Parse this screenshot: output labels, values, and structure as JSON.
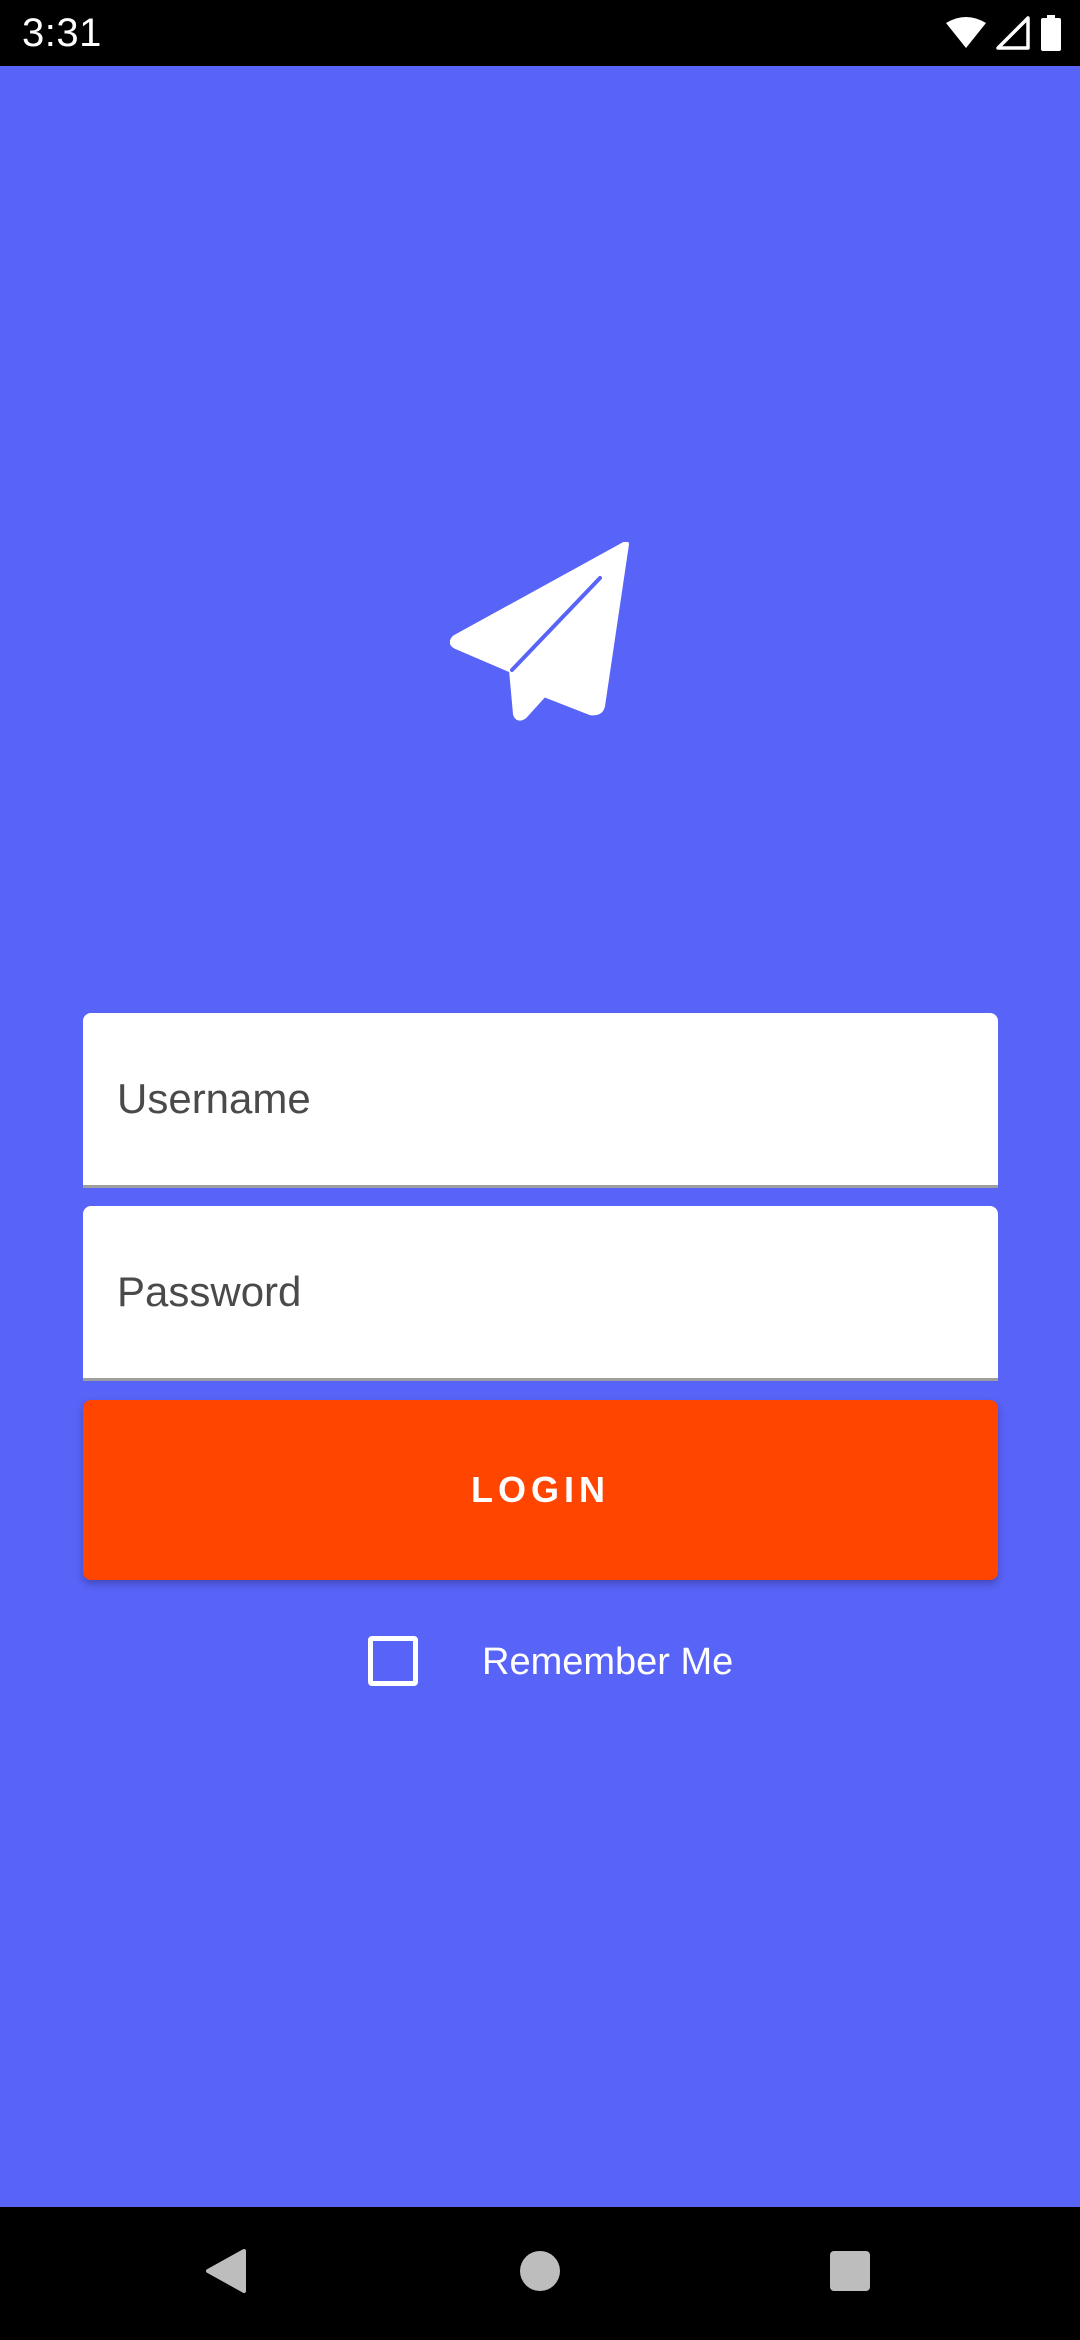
{
  "status_bar": {
    "time": "3:31",
    "icons": [
      "wifi-icon",
      "signal-icon",
      "battery-icon"
    ]
  },
  "app": {
    "background_color": "#5863F8",
    "logo_icon": "paper-plane-icon"
  },
  "login_form": {
    "username": {
      "value": "",
      "placeholder": "Username"
    },
    "password": {
      "value": "",
      "placeholder": "Password"
    },
    "login_button": {
      "label": "LOGIN",
      "color": "#FF4500"
    },
    "remember_me": {
      "label": "Remember Me",
      "checked": false
    }
  },
  "navigation_bar": {
    "buttons": [
      "back-icon",
      "home-icon",
      "recents-icon"
    ]
  }
}
